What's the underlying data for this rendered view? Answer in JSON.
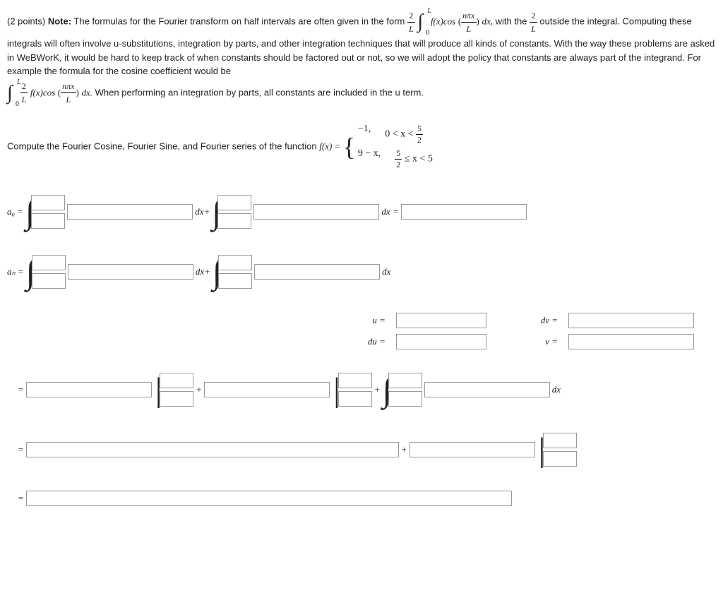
{
  "points_label": "(2 points)",
  "note_bold": "Note:",
  "note_text_1": "The formulas for the Fourier transform on half intervals are often given in the form",
  "note_text_2": "with the",
  "note_text_3": "outside the integral. Computing these integrals will often involve u-substitutions, integration by parts, and other integration techniques that will produce all kinds of constants. With the way these problems are asked in WeBWorK, it would be hard to keep track of when constants should be factored out or not, so we will adopt the policy that constants are always part of the integrand. For example the formula for the cosine coefficient would be",
  "frac1_num": "2",
  "frac1_den": "L",
  "int1_ub": "L",
  "int1_lb": "0",
  "fx": "f(x)cos",
  "frac2_num": "nπx",
  "frac2_den": "L",
  "dx_label": "dx,",
  "frac3_num": "2",
  "frac3_den": "L",
  "formula2_pre": "",
  "int2_ub": "L",
  "int2_lb": "0",
  "frac4_num": "2",
  "frac4_den": "L",
  "frac5_num": "nπx",
  "frac5_den": "L",
  "dx2": "dx.",
  "note_text_4": "When performing an integration by parts, all constants are included in the u term.",
  "compute_text": "Compute the Fourier Cosine, Fourier Sine, and Fourier series of the function",
  "fx_eq": "f(x) =",
  "piece1_val": "−1,",
  "piece1_cond": "0 < x <",
  "piece1_frac_num": "5",
  "piece1_frac_den": "2",
  "piece2_val": "9 − x,",
  "piece2_frac_num": "5",
  "piece2_frac_den": "2",
  "piece2_cond": "≤ x < 5",
  "a0": "a₀ =",
  "an": "aₙ =",
  "dxplus": "dx+",
  "dxeq": "dx =",
  "dx": "dx",
  "u_lbl": "u =",
  "dv_lbl": "dv =",
  "du_lbl": "du =",
  "v_lbl": "v =",
  "eq": "=",
  "plus": "+"
}
